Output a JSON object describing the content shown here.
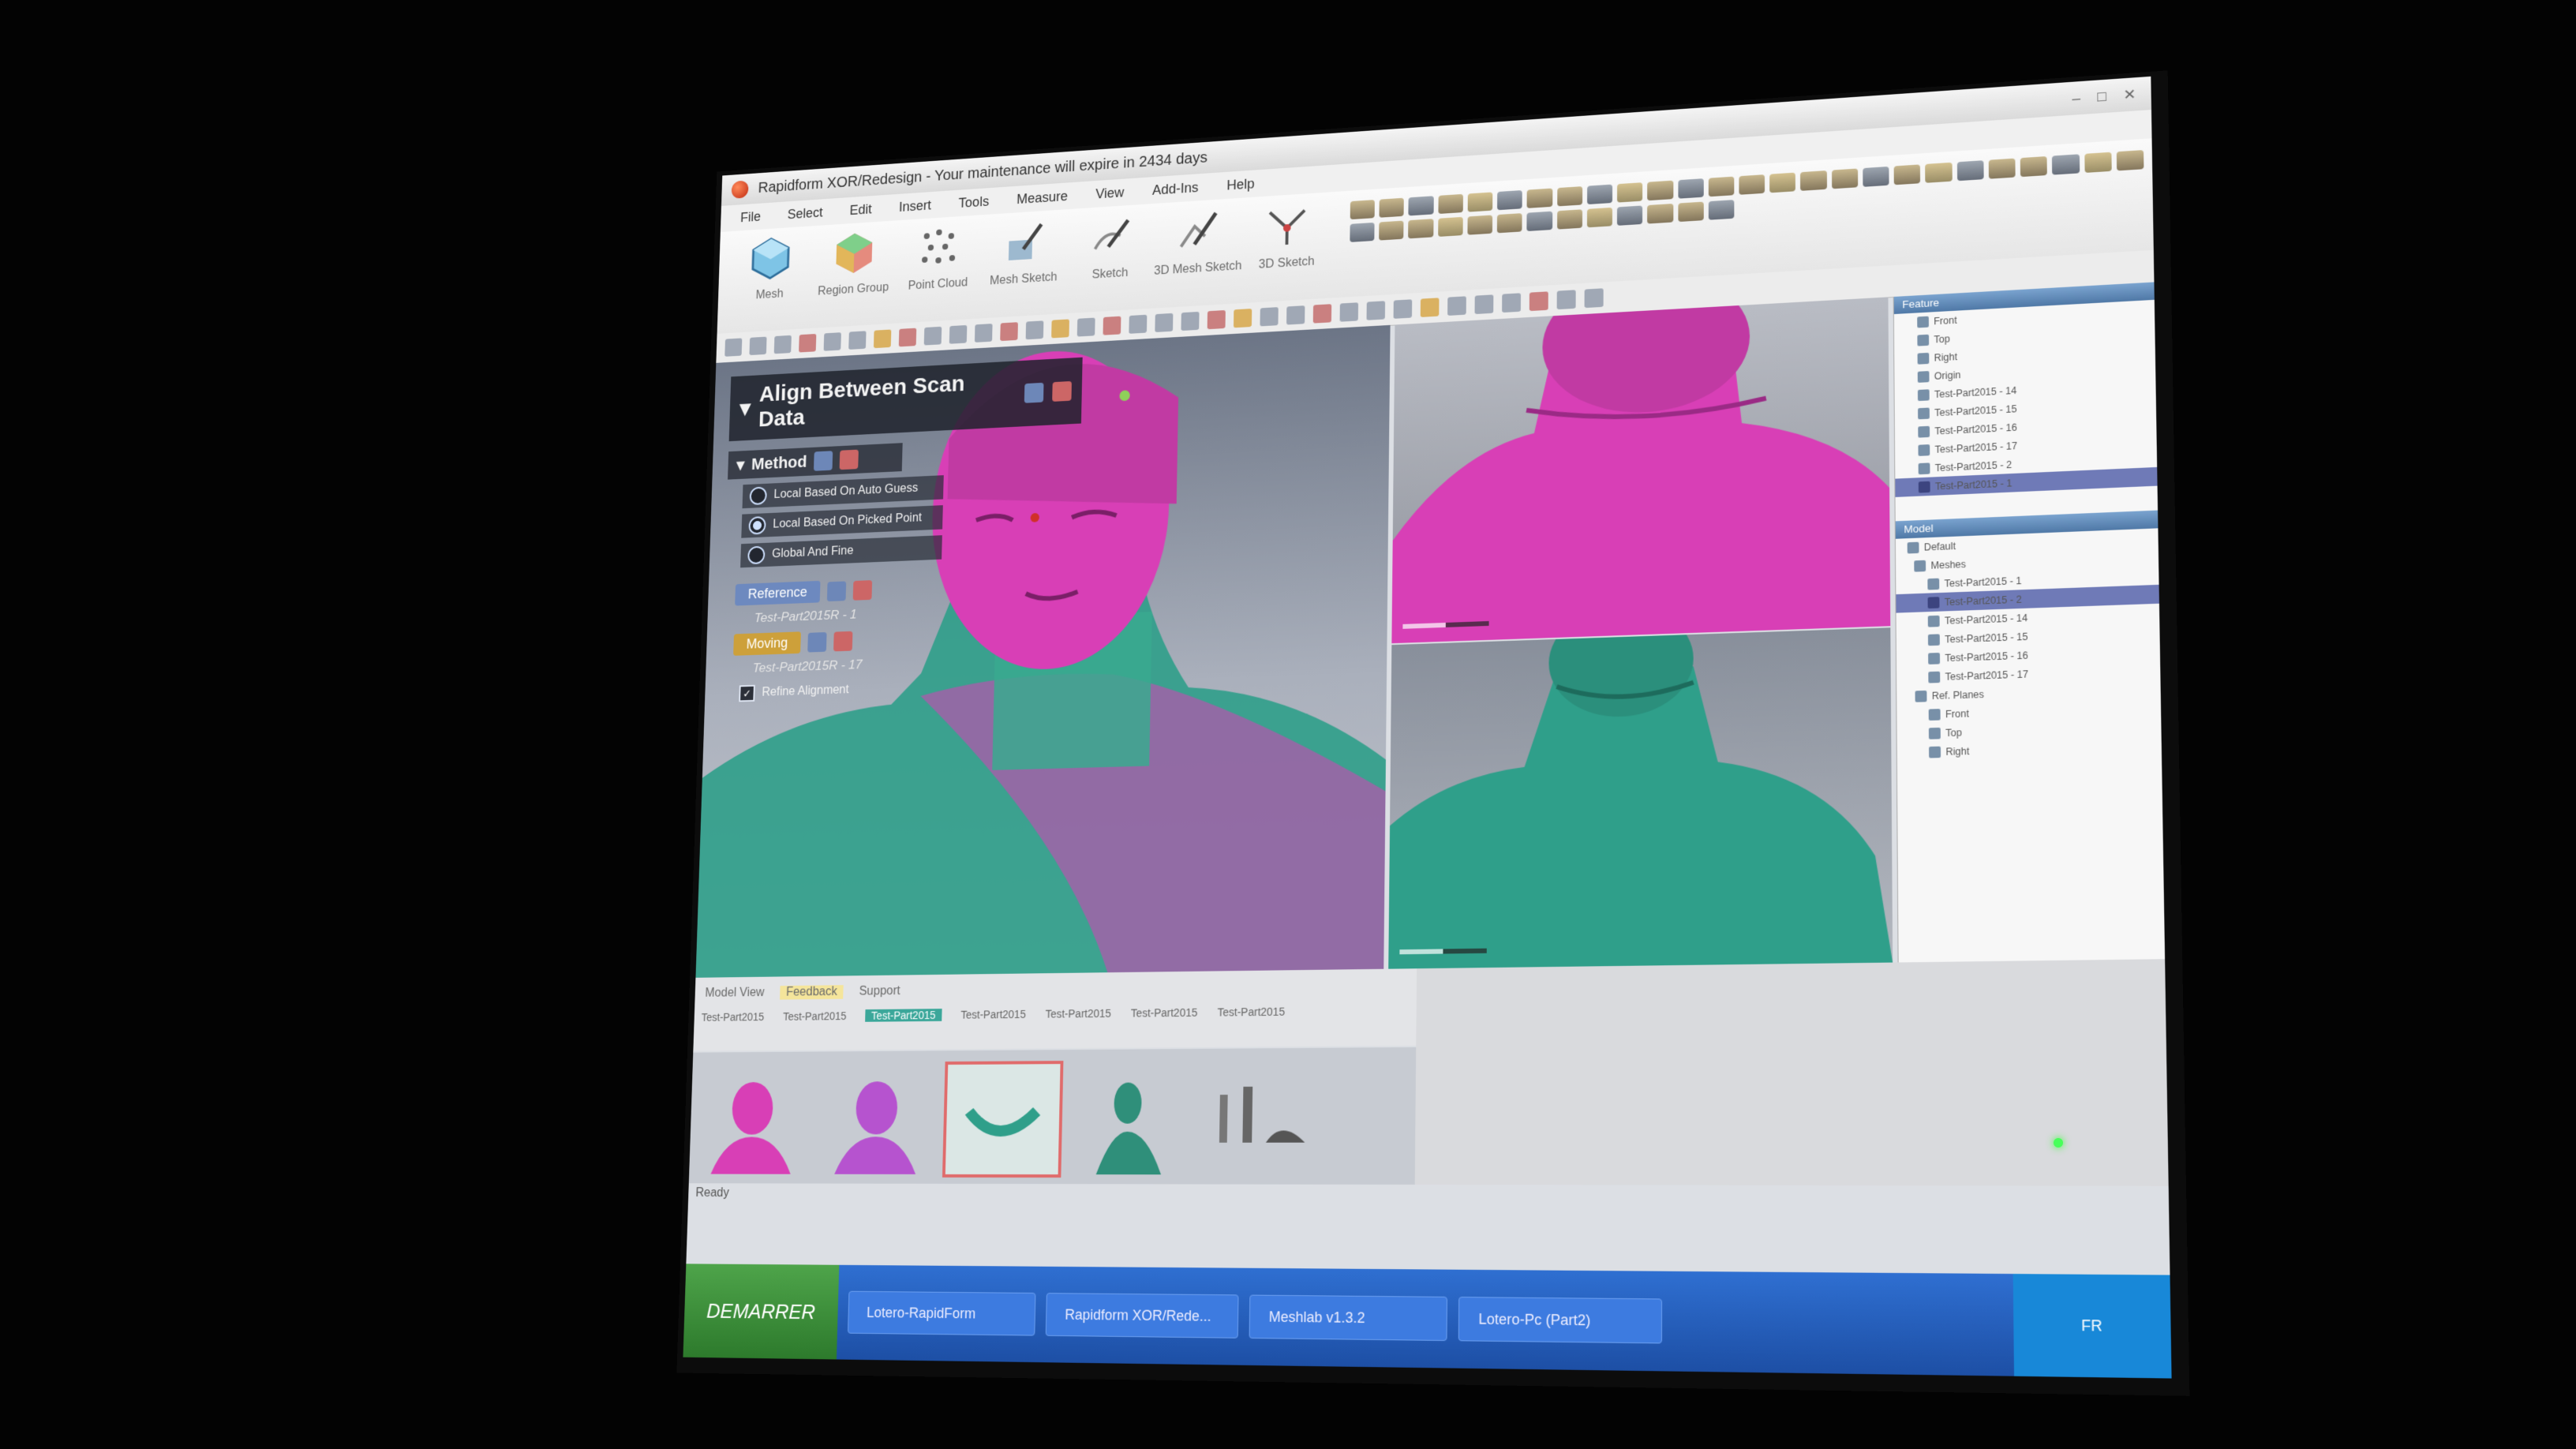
{
  "window": {
    "title": "Rapidform XOR/Redesign - Your maintenance will expire in  2434 days",
    "controls": [
      "–",
      "□",
      "✕"
    ]
  },
  "menu": [
    "File",
    "Select",
    "Edit",
    "Insert",
    "Tools",
    "Measure",
    "View",
    "Add-Ins",
    "Help"
  ],
  "ribbon": {
    "mode_buttons": [
      {
        "label": "Mesh",
        "icon": "mesh-icon"
      },
      {
        "label": "Region Group",
        "icon": "region-group-icon"
      },
      {
        "label": "Point Cloud",
        "icon": "point-cloud-icon"
      },
      {
        "label": "Mesh Sketch",
        "icon": "mesh-sketch-icon"
      },
      {
        "label": "Sketch",
        "icon": "sketch-icon"
      },
      {
        "label": "3D Mesh Sketch",
        "icon": "3d-mesh-sketch-icon"
      },
      {
        "label": "3D Sketch",
        "icon": "3d-sketch-icon"
      }
    ]
  },
  "dialog": {
    "title": "Align Between Scan Data",
    "method_header": "Method",
    "method_options": [
      {
        "label": "Local Based On Auto Guess",
        "selected": false
      },
      {
        "label": "Local Based On Picked Point",
        "selected": true
      },
      {
        "label": "Global And Fine",
        "selected": false
      }
    ],
    "reference_label": "Reference",
    "reference_value": "Test-Part2015R - 1",
    "moving_label": "Moving",
    "moving_value": "Test-Part2015R - 17",
    "refine_label": "Refine Alignment",
    "refine_checked": true
  },
  "tree": {
    "features_header": "Feature",
    "features": [
      "Front",
      "Top",
      "Right",
      "Origin",
      "Test-Part2015 - 14",
      "Test-Part2015 - 15",
      "Test-Part2015 - 16",
      "Test-Part2015 - 17",
      "Test-Part2015 - 2",
      "Test-Part2015 - 1"
    ],
    "model_header": "Model",
    "model_items": [
      "Default",
      "Meshes",
      "Test-Part2015 - 1",
      "Test-Part2015 - 2",
      "Test-Part2015 - 14",
      "Test-Part2015 - 15",
      "Test-Part2015 - 16",
      "Test-Part2015 - 17",
      "Ref. Planes",
      "Front",
      "Top",
      "Right"
    ]
  },
  "bottom": {
    "tabs": [
      "Model View",
      "Feedback",
      "Support"
    ],
    "active_tab": "Feedback",
    "file_tabs": [
      "Test-Part2015",
      "Test-Part2015",
      "Test-Part2015",
      "Test-Part2015",
      "Test-Part2015",
      "Test-Part2015",
      "Test-Part2015"
    ],
    "active_file_tab": "Test-Part2015",
    "status": "Ready"
  },
  "taskbar": {
    "start_label": "DEMARRER",
    "tasks": [
      "Lotero-RapidForm",
      "Rapidform XOR/Rede...",
      "Meshlab v1.3.2",
      "Lotero-Pc (Part2)"
    ],
    "tray": "FR"
  },
  "colors": {
    "scan_pink": "#d83fb6",
    "scan_teal": "#2f9f8a",
    "accent_blue": "#4f78a6",
    "moving_gold": "#cda03a"
  }
}
